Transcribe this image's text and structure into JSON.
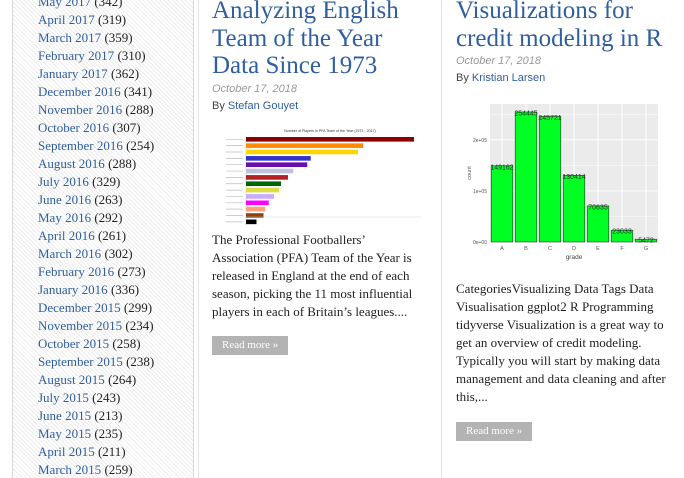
{
  "sidebar": {
    "archives": [
      {
        "month": "May 2017",
        "count": "(342)"
      },
      {
        "month": "April 2017",
        "count": "(319)"
      },
      {
        "month": "March 2017",
        "count": "(359)"
      },
      {
        "month": "February 2017",
        "count": "(310)"
      },
      {
        "month": "January 2017",
        "count": "(362)"
      },
      {
        "month": "December 2016",
        "count": "(341)"
      },
      {
        "month": "November 2016",
        "count": "(288)"
      },
      {
        "month": "October 2016",
        "count": "(307)"
      },
      {
        "month": "September 2016",
        "count": "(254)"
      },
      {
        "month": "August 2016",
        "count": "(288)"
      },
      {
        "month": "July 2016",
        "count": "(329)"
      },
      {
        "month": "June 2016",
        "count": "(263)"
      },
      {
        "month": "May 2016",
        "count": "(292)"
      },
      {
        "month": "April 2016",
        "count": "(261)"
      },
      {
        "month": "March 2016",
        "count": "(302)"
      },
      {
        "month": "February 2016",
        "count": "(273)"
      },
      {
        "month": "January 2016",
        "count": "(336)"
      },
      {
        "month": "December 2015",
        "count": "(299)"
      },
      {
        "month": "November 2015",
        "count": "(234)"
      },
      {
        "month": "October 2015",
        "count": "(258)"
      },
      {
        "month": "September 2015",
        "count": "(238)"
      },
      {
        "month": "August 2015",
        "count": "(264)"
      },
      {
        "month": "July 2015",
        "count": "(243)"
      },
      {
        "month": "June 2015",
        "count": "(213)"
      },
      {
        "month": "May 2015",
        "count": "(235)"
      },
      {
        "month": "April 2015",
        "count": "(211)"
      },
      {
        "month": "March 2015",
        "count": "(259)"
      }
    ]
  },
  "posts": [
    {
      "title": "Analyzing English Team of the Year Data Since 1973",
      "date": "October 17, 2018",
      "by": "By",
      "author": "Stefan Gouyet",
      "excerpt": "The Professional Footballers’ Association (PFA) Team of the Year is released in England at the end of each season, picking the 11 most influential players in each of Britain’s leagues....",
      "read_more": "Read more »",
      "thumbnail": {
        "chart_title": "Number of Players in PFA Team of the Year (1973 - 2017)",
        "bars": [
          {
            "value": 96,
            "color": "#8b0000"
          },
          {
            "value": 67,
            "color": "#ff8c00"
          },
          {
            "value": 64,
            "color": "#ffd700"
          },
          {
            "value": 37,
            "color": "#3333cc"
          },
          {
            "value": 35,
            "color": "#6a0dad"
          },
          {
            "value": 27,
            "color": "#c0c0e0"
          },
          {
            "value": 24,
            "color": "#b22222"
          },
          {
            "value": 20,
            "color": "#006400"
          },
          {
            "value": 19,
            "color": "#dddd44"
          },
          {
            "value": 16,
            "color": "#ccaaff"
          },
          {
            "value": 13,
            "color": "#ff00ff"
          },
          {
            "value": 11,
            "color": "#ffa07a"
          },
          {
            "value": 10,
            "color": "#8b4513"
          },
          {
            "value": 6,
            "color": "#000000"
          }
        ]
      }
    },
    {
      "title": "Visualizations for credit modeling in R",
      "date": "October 17, 2018",
      "by": "By",
      "author": "Kristian Larsen",
      "excerpt": "CategoriesVisualizing Data Tags Data Visualisation ggplot2 R Programming tidyverse Visualization is a great way to get an overview of credit modeling. Typically you will start by making data management and data cleaning and after this,...",
      "read_more": "Read more »",
      "thumbnail": {
        "type": "bar",
        "xlabel": "grade",
        "ylabel": "count",
        "categories": [
          "A",
          "B",
          "C",
          "D",
          "E",
          "F",
          "G"
        ],
        "values": [
          149162,
          254445,
          245721,
          130414,
          70635,
          23033,
          5472
        ],
        "value_labels": [
          "149162",
          "254445",
          "245721",
          "130414",
          "70635",
          "23033",
          "5472"
        ],
        "y_ticks": [
          "0e+00",
          "1e+05",
          "2e+05"
        ],
        "ylim": [
          0,
          270000
        ],
        "bar_color": "#00ff22",
        "panel_color": "#ebebeb"
      }
    }
  ]
}
